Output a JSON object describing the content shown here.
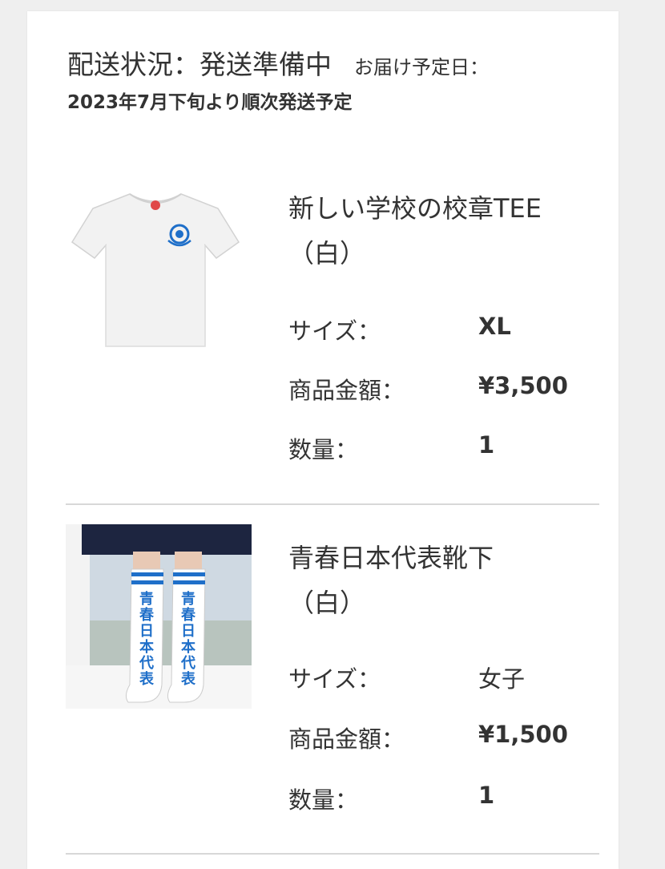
{
  "status": {
    "label": "配送状況：",
    "value": "発送準備中",
    "delivery_label": "お届け予定日：",
    "schedule": "2023年7月下旬より順次発送予定"
  },
  "items": [
    {
      "name": "新しい学校の校章TEE",
      "color": "（白）",
      "size_label": "サイズ：",
      "size_value": "XL",
      "price_label": "商品金額：",
      "price_value": "¥3,500",
      "qty_label": "数量：",
      "qty_value": "1"
    },
    {
      "name": "青春日本代表靴下",
      "color": "（白）",
      "size_label": "サイズ：",
      "size_value": "女子",
      "price_label": "商品金額：",
      "price_value": "¥1,500",
      "qty_label": "数量：",
      "qty_value": "1",
      "sock_text_left": "青春日本代表",
      "sock_text_right": "青春日本代表"
    }
  ],
  "colors": {
    "background": "#efefef",
    "card": "#ffffff",
    "text": "#333333",
    "divider": "#d8d8d8",
    "emblem_blue": "#1f6fc9"
  }
}
